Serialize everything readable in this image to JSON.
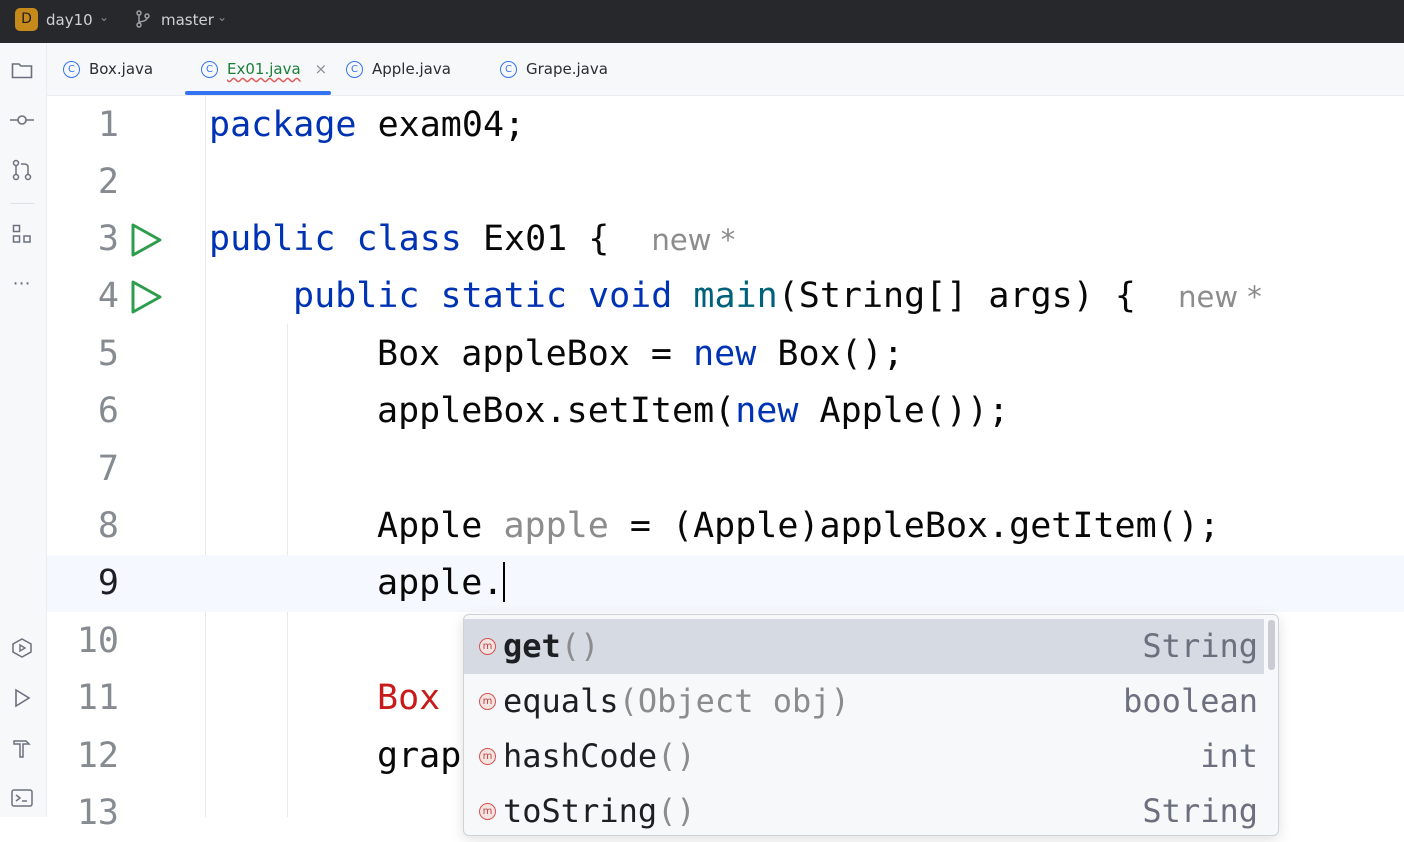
{
  "titlebar": {
    "project_badge": "D",
    "project_name": "day10",
    "branch": "master"
  },
  "tabs": [
    {
      "label": "Box.java",
      "icon": "class-icon"
    },
    {
      "label": "Ex01.java",
      "icon": "class-icon",
      "active": true
    },
    {
      "label": "Apple.java",
      "icon": "class-icon"
    },
    {
      "label": "Grape.java",
      "icon": "class-icon"
    }
  ],
  "tab_close": "×",
  "editor": {
    "line_numbers": [
      "1",
      "2",
      "3",
      "4",
      "5",
      "6",
      "7",
      "8",
      "9",
      "10",
      "11",
      "12",
      "13"
    ],
    "lines": {
      "l1": {
        "kw": "package",
        "rest": " exam04;"
      },
      "l3": {
        "kw1": "public",
        "kw2": "class",
        "rest": " Ex01 {",
        "hint": "new *"
      },
      "l4": {
        "kw1": "public",
        "kw2": "static",
        "kw3": "void",
        "fn": "main",
        "rest": "(String[] args) {",
        "hint": "new *"
      },
      "l5": {
        "a": "Box appleBox = ",
        "kw": "new",
        "b": " Box();"
      },
      "l6": {
        "a": "appleBox.setItem(",
        "kw": "new",
        "b": " Apple());"
      },
      "l8": {
        "a": "Apple ",
        "var": "apple",
        "b": " = (Apple)appleBox.getItem();"
      },
      "l9": {
        "a": "apple."
      },
      "l11": {
        "err": "Box"
      },
      "l12": {
        "a": "grap"
      }
    }
  },
  "completion": {
    "items": [
      {
        "icon": "m",
        "name": "get",
        "params": "()",
        "type": "String",
        "selected": true
      },
      {
        "icon": "m",
        "name": "equals",
        "params": "(Object obj)",
        "type": "boolean"
      },
      {
        "icon": "m",
        "name": "hashCode",
        "params": "()",
        "type": "int"
      },
      {
        "icon": "m",
        "name": "toString",
        "params": "()",
        "type": "String"
      }
    ]
  },
  "colors": {
    "keyword": "#0033b3",
    "function": "#00627a",
    "run_icon": "#2e9d4e",
    "accent": "#3574f0",
    "error": "#c91a1a"
  }
}
